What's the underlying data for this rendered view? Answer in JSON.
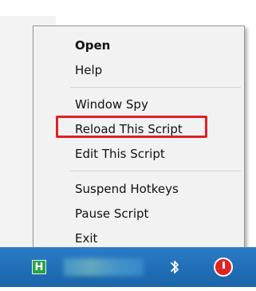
{
  "menu": {
    "items": [
      {
        "label": "Open",
        "bold": true
      },
      {
        "label": "Help"
      },
      {
        "label": "Window Spy"
      },
      {
        "label": "Reload This Script",
        "highlighted": true
      },
      {
        "label": "Edit This Script"
      },
      {
        "label": "Suspend Hotkeys"
      },
      {
        "label": "Pause Script"
      },
      {
        "label": "Exit"
      }
    ],
    "highlight_color": "#e01f26"
  },
  "taskbar": {
    "color": "#1a6bb6",
    "tray": {
      "autohotkey_icon_letter": "H",
      "icons": [
        "autohotkey-icon",
        "blurred-app-icons",
        "bluetooth-icon",
        "red-clock-icon"
      ]
    }
  }
}
